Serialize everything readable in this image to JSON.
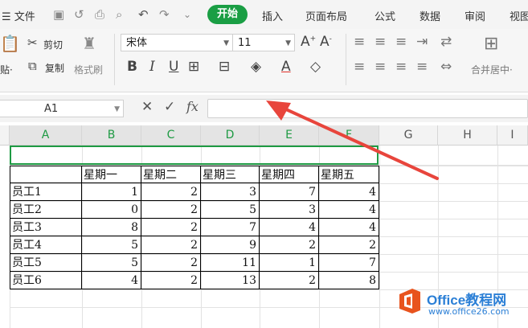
{
  "menu": {
    "file": "文件",
    "tabs": [
      "开始",
      "插入",
      "页面布局",
      "公式",
      "数据",
      "审阅",
      "视图"
    ]
  },
  "ribbon": {
    "cut": "剪切",
    "paste": "贴·",
    "copy": "复制",
    "format_painter": "格式刷",
    "font_name": "宋体",
    "font_size": "11",
    "merge_center": "合并居中·"
  },
  "formula_bar": {
    "name_box": "A1",
    "fx": "fx",
    "content": ""
  },
  "sheet": {
    "col_headers": [
      "A",
      "B",
      "C",
      "D",
      "E",
      "F",
      "G",
      "H",
      "I"
    ],
    "header_row": [
      "",
      "星期一",
      "星期二",
      "星期三",
      "星期四",
      "星期五"
    ],
    "rows": [
      {
        "name": "员工1",
        "values": [
          "1",
          "2",
          "3",
          "7",
          "4"
        ]
      },
      {
        "name": "员工2",
        "values": [
          "0",
          "2",
          "5",
          "3",
          "4"
        ]
      },
      {
        "name": "员工3",
        "values": [
          "8",
          "2",
          "7",
          "4",
          "4"
        ]
      },
      {
        "name": "员工4",
        "values": [
          "5",
          "2",
          "9",
          "2",
          "2"
        ]
      },
      {
        "name": "员工5",
        "values": [
          "5",
          "2",
          "11",
          "1",
          "7"
        ]
      },
      {
        "name": "员工6",
        "values": [
          "4",
          "2",
          "13",
          "2",
          "8"
        ]
      }
    ]
  },
  "watermark": {
    "brand": "Office教程网",
    "url": "www.office26.com"
  },
  "colors": {
    "accent": "#1a9e44",
    "arrow": "#e8453c",
    "watermark": "#2b7fd6"
  }
}
